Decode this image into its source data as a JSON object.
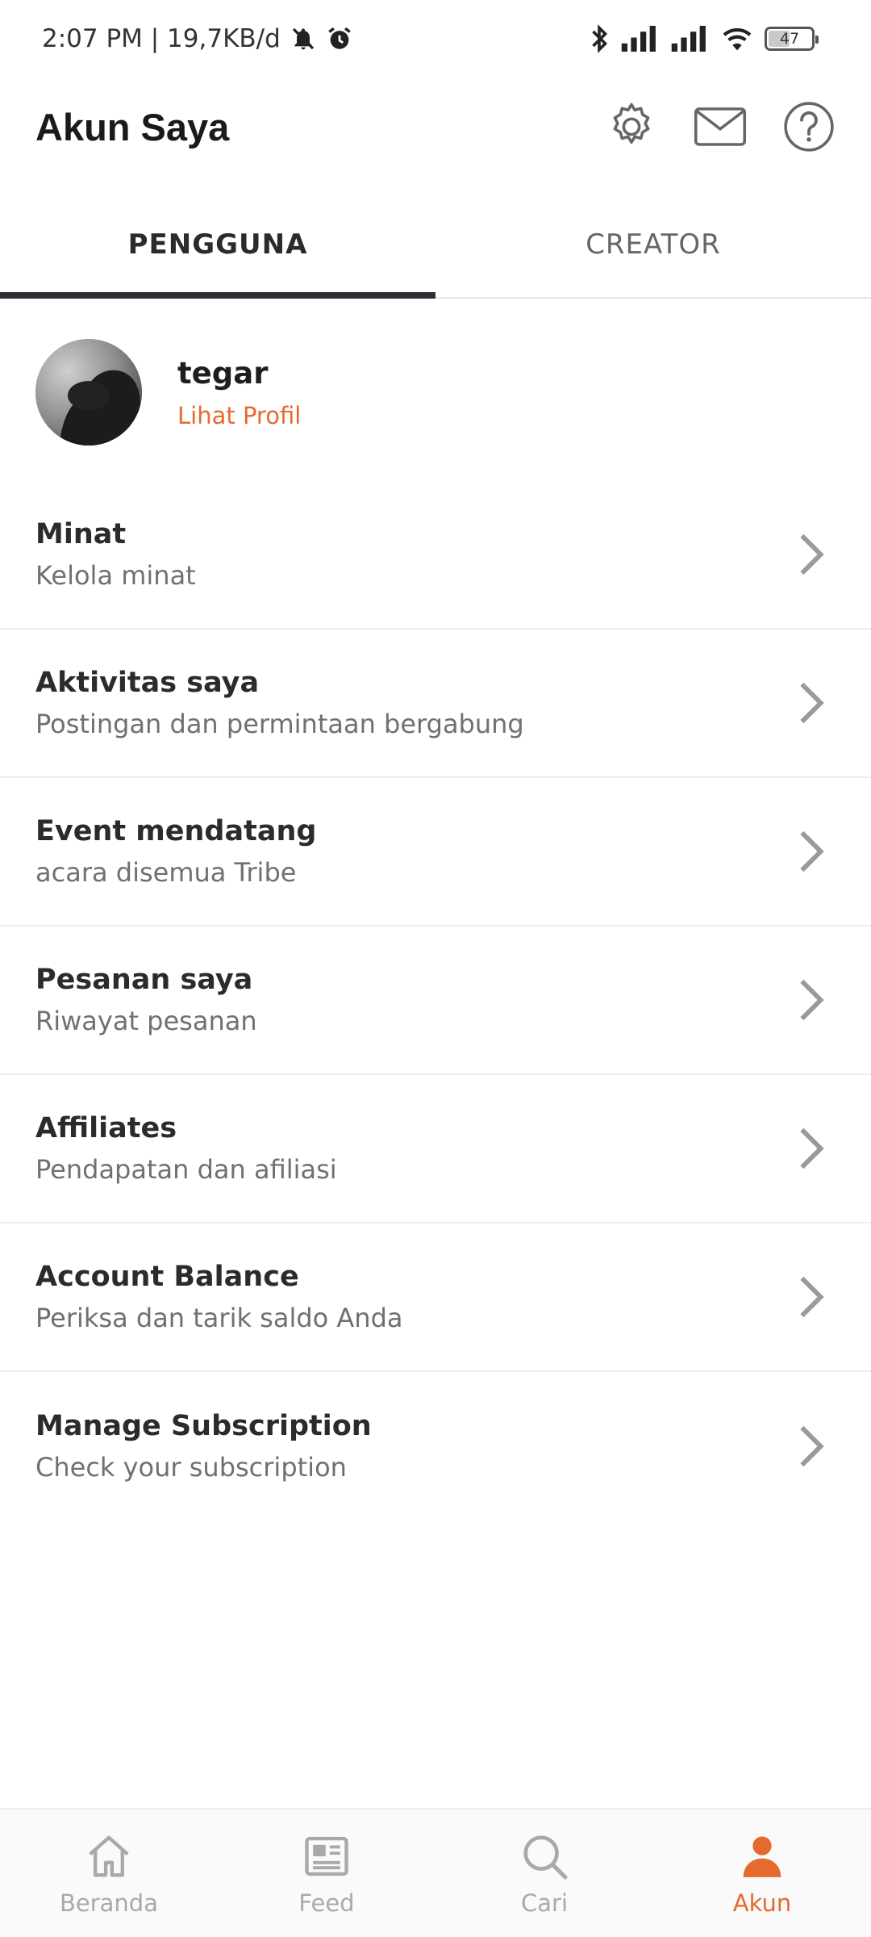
{
  "status_bar": {
    "time_and_speed": "2:07 PM | 19,7KB/d",
    "battery_level": "47"
  },
  "header": {
    "title": "Akun Saya",
    "icons": [
      "settings-icon",
      "mail-icon",
      "help-icon"
    ]
  },
  "tabs": [
    {
      "label": "PENGGUNA",
      "active": true
    },
    {
      "label": "CREATOR",
      "active": false
    }
  ],
  "profile": {
    "name": "tegar",
    "link_label": "Lihat Profil"
  },
  "menu": {
    "items": [
      {
        "title": "Minat",
        "subtitle": "Kelola minat"
      },
      {
        "title": "Aktivitas saya",
        "subtitle": "Postingan dan permintaan bergabung"
      },
      {
        "title": "Event mendatang",
        "subtitle": "acara disemua Tribe"
      },
      {
        "title": "Pesanan saya",
        "subtitle": "Riwayat pesanan"
      },
      {
        "title": "Affiliates",
        "subtitle": "Pendapatan dan afiliasi"
      },
      {
        "title": "Account Balance",
        "subtitle": "Periksa dan tarik saldo Anda"
      },
      {
        "title": "Manage Subscription",
        "subtitle": "Check your subscription"
      }
    ]
  },
  "bottom_nav": {
    "items": [
      {
        "label": "Beranda",
        "icon": "home-icon",
        "active": false
      },
      {
        "label": "Feed",
        "icon": "feed-icon",
        "active": false
      },
      {
        "label": "Cari",
        "icon": "search-icon",
        "active": false
      },
      {
        "label": "Akun",
        "icon": "account-icon",
        "active": true
      }
    ]
  },
  "colors": {
    "accent": "#e46a2d",
    "tab_indicator": "#2c3034",
    "inactive_nav": "#a9a9a9"
  }
}
